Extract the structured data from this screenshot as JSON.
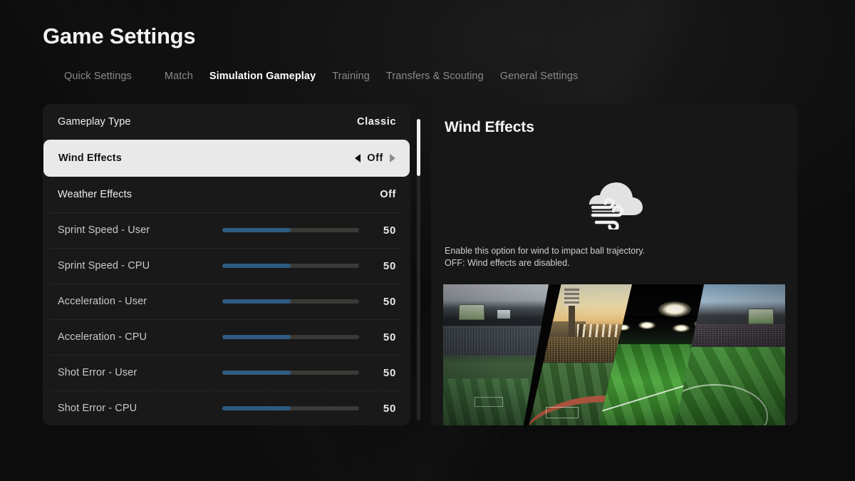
{
  "header": {
    "title": "Game Settings",
    "tabs": [
      {
        "label": "Quick Settings",
        "active": false
      },
      {
        "label": "Match",
        "active": false
      },
      {
        "label": "Simulation Gameplay",
        "active": true
      },
      {
        "label": "Training",
        "active": false
      },
      {
        "label": "Transfers & Scouting",
        "active": false
      },
      {
        "label": "General Settings",
        "active": false
      }
    ]
  },
  "settings_list": {
    "rows": [
      {
        "label": "Gameplay Type",
        "type": "option",
        "value": "Classic",
        "selected": false
      },
      {
        "label": "Wind Effects",
        "type": "option",
        "value": "Off",
        "selected": true,
        "left_arrow": "◀",
        "right_arrow": "▶"
      },
      {
        "label": "Weather Effects",
        "type": "option",
        "value": "Off",
        "selected": false
      },
      {
        "label": "Sprint Speed - User",
        "type": "slider",
        "value": "50",
        "percent": 50,
        "selected": false
      },
      {
        "label": "Sprint Speed - CPU",
        "type": "slider",
        "value": "50",
        "percent": 50,
        "selected": false
      },
      {
        "label": "Acceleration - User",
        "type": "slider",
        "value": "50",
        "percent": 50,
        "selected": false
      },
      {
        "label": "Acceleration - CPU",
        "type": "slider",
        "value": "50",
        "percent": 50,
        "selected": false
      },
      {
        "label": "Shot Error - User",
        "type": "slider",
        "value": "50",
        "percent": 50,
        "selected": false
      },
      {
        "label": "Shot Error - CPU",
        "type": "slider",
        "value": "50",
        "percent": 50,
        "selected": false
      }
    ]
  },
  "scrollbar": {
    "thumb_position_percent": 0,
    "thumb_size_percent": 19
  },
  "detail": {
    "title": "Wind Effects",
    "icon": "wind-cloud-icon",
    "description_line1": "Enable this option for wind to impact ball trajectory.",
    "description_line2": "OFF: Wind effects are disabled.",
    "image_caption": "stadium-montage"
  },
  "colors": {
    "background": "#0d0d0d",
    "panel": "#191919",
    "selected_row": "#e9e9e9",
    "selected_row_text": "#121212",
    "slider_fill": "#2f5b80",
    "slider_track": "#3a3936",
    "text_primary": "#f2f2f2",
    "text_secondary": "#c9c9c9",
    "text_muted": "#8a8a8a",
    "scrollbar_thumb": "#f0f0f0"
  }
}
